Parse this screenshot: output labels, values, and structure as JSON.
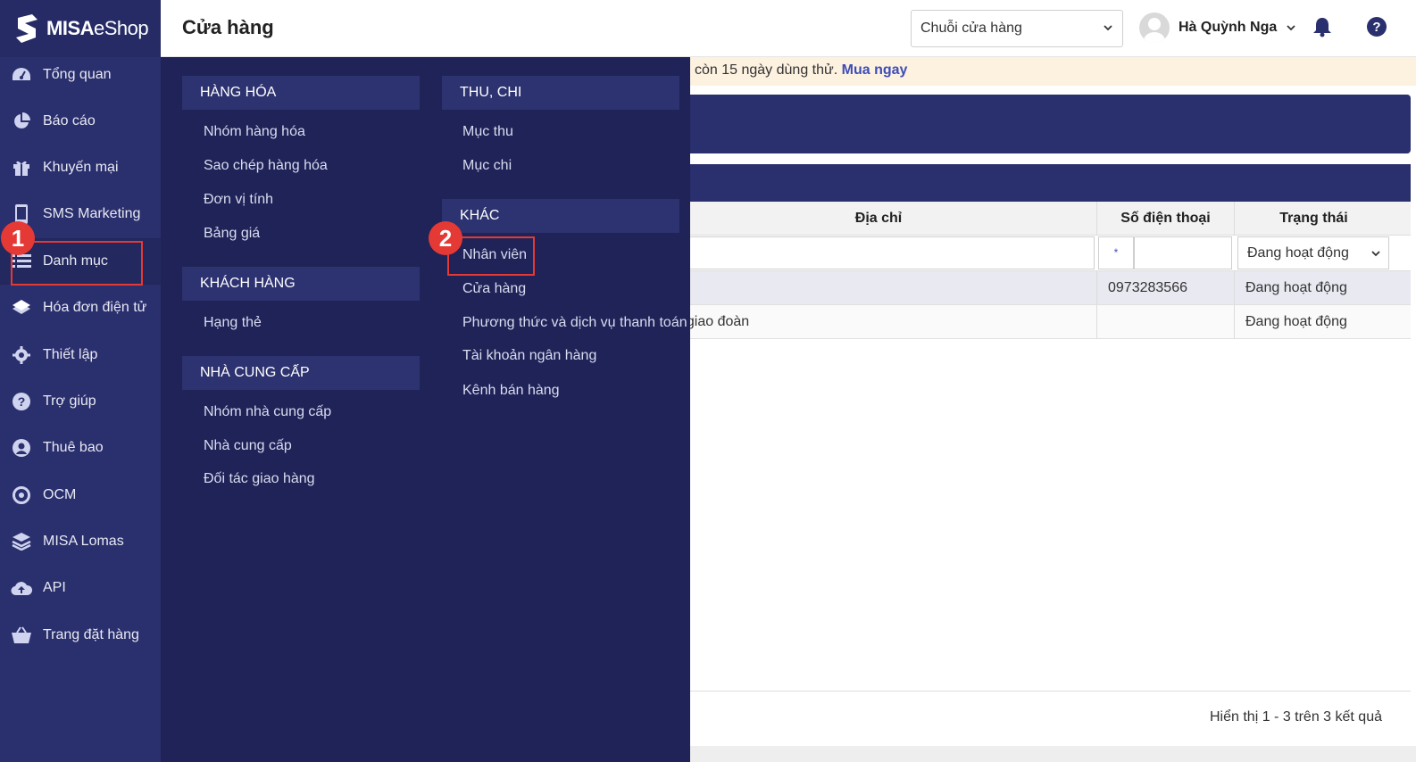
{
  "app": {
    "logo_text_bold": "MISA",
    "logo_text": "eShop",
    "page_title": "Cửa hàng"
  },
  "header": {
    "store_select": "Chuỗi cửa hàng",
    "user_name": "Hà Quỳnh Nga"
  },
  "sidebar": {
    "items": [
      {
        "label": "Tổng quan",
        "icon": "dashboard-icon"
      },
      {
        "label": "Báo cáo",
        "icon": "pie-chart-icon"
      },
      {
        "label": "Khuyến mại",
        "icon": "gift-icon"
      },
      {
        "label": "SMS Marketing",
        "icon": "phone-icon"
      },
      {
        "label": "Danh mục",
        "icon": "list-icon"
      },
      {
        "label": "Hóa đơn điện tử",
        "icon": "invoice-icon"
      },
      {
        "label": "Thiết lập",
        "icon": "gear-icon"
      },
      {
        "label": "Trợ giúp",
        "icon": "question-icon"
      },
      {
        "label": "Thuê bao",
        "icon": "user-circle-icon"
      },
      {
        "label": "OCM",
        "icon": "ocm-icon"
      },
      {
        "label": "MISA Lomas",
        "icon": "layers-icon"
      },
      {
        "label": "API",
        "icon": "cloud-upload-icon"
      },
      {
        "label": "Trang đặt hàng",
        "icon": "basket-icon"
      }
    ]
  },
  "trial": {
    "text": "còn 15 ngày dùng thử.",
    "link": "Mua ngay"
  },
  "table": {
    "headers": [
      "Địa chỉ",
      "Số điện thoại",
      "Trạng thái"
    ],
    "filter_operator": "*",
    "filter_status": "Đang hoạt động",
    "rows": [
      {
        "address": "",
        "phone": "0973283566",
        "status": "Đang hoạt động"
      },
      {
        "address": "ại giao đoàn",
        "phone": "",
        "status": "Đang hoạt động"
      }
    ],
    "footer": "Hiển thị 1 - 3 trên 3 kết quả"
  },
  "menu": {
    "hang_hoa": {
      "title": "HÀNG HÓA",
      "items": [
        "Nhóm hàng hóa",
        "Sao chép hàng hóa",
        "Đơn vị tính",
        "Bảng giá"
      ]
    },
    "khach_hang": {
      "title": "KHÁCH HÀNG",
      "items": [
        "Hạng thẻ"
      ]
    },
    "nha_cung_cap": {
      "title": "NHÀ CUNG CẤP",
      "items": [
        "Nhóm nhà cung cấp",
        "Nhà cung cấp",
        "Đối tác giao hàng"
      ]
    },
    "thu_chi": {
      "title": "THU, CHI",
      "items": [
        "Mục thu",
        "Mục chi"
      ]
    },
    "khac": {
      "title": "KHÁC",
      "items": [
        "Nhân viên",
        "Cửa hàng",
        "Phương thức và dịch vụ thanh toán",
        "Tài khoản ngân hàng",
        "Kênh bán hàng"
      ]
    }
  },
  "callouts": [
    "1",
    "2"
  ],
  "colors": {
    "sidebar": "#2a2f6d",
    "menu": "#1f2357",
    "accent": "#e53935",
    "link": "#3d4db8"
  }
}
